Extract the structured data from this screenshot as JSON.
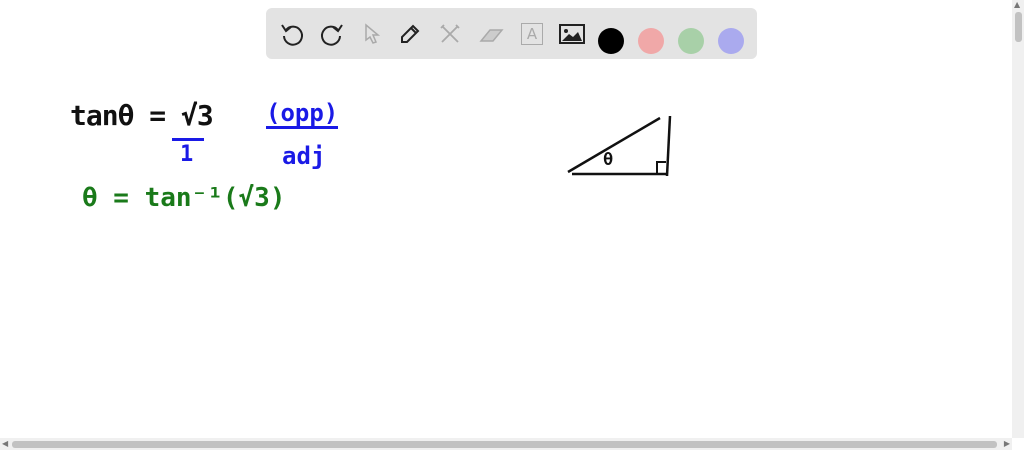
{
  "toolbar": {
    "tools": [
      "undo-icon",
      "redo-icon",
      "select-icon",
      "pen-icon",
      "tools-icon",
      "eraser-icon",
      "text-icon",
      "image-icon"
    ],
    "text_tool_label": "A",
    "colors": [
      "#000000",
      "#f0a8a8",
      "#a8d0a8",
      "#aaaaee"
    ]
  },
  "canvas": {
    "line1": "tanθ = √3",
    "line1_denominator": "1",
    "ratio_numerator": "(opp)",
    "ratio_denominator": "adj",
    "line2": "θ = tan⁻¹(√3)",
    "triangle_angle": "θ",
    "ink_black": "#111111",
    "ink_blue": "#1a1ae6",
    "ink_green": "#1a7a1a"
  }
}
